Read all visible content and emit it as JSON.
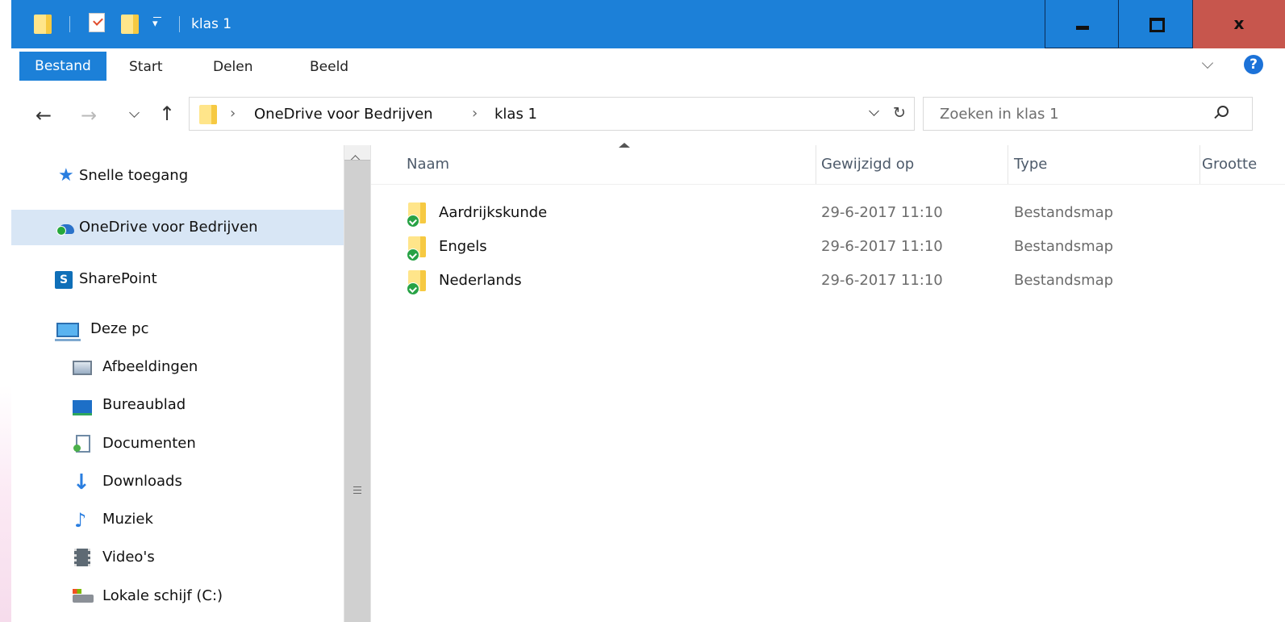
{
  "window": {
    "title": "klas 1",
    "close_label": "x"
  },
  "ribbon": {
    "tabs": [
      {
        "label": "Bestand"
      },
      {
        "label": "Start"
      },
      {
        "label": "Delen"
      },
      {
        "label": "Beeld"
      }
    ],
    "help_label": "?"
  },
  "address": {
    "segments": [
      "OneDrive voor Bedrijven",
      "klas 1"
    ]
  },
  "search": {
    "placeholder": "Zoeken in klas 1"
  },
  "nav_pane": {
    "items": [
      {
        "label": "Snelle toegang",
        "icon": "star-icon"
      },
      {
        "label": "OneDrive voor Bedrijven",
        "icon": "onedrive-icon",
        "selected": true
      },
      {
        "label": "SharePoint",
        "icon": "sharepoint-icon"
      },
      {
        "label": "Deze pc",
        "icon": "pc-icon"
      },
      {
        "label": "Afbeeldingen",
        "icon": "pictures-icon"
      },
      {
        "label": "Bureaublad",
        "icon": "desktop-icon"
      },
      {
        "label": "Documenten",
        "icon": "documents-icon"
      },
      {
        "label": "Downloads",
        "icon": "download-icon"
      },
      {
        "label": "Muziek",
        "icon": "music-icon"
      },
      {
        "label": "Video's",
        "icon": "video-icon"
      },
      {
        "label": "Lokale schijf (C:)",
        "icon": "drive-icon"
      }
    ]
  },
  "file_list": {
    "columns": [
      "Naam",
      "Gewijzigd op",
      "Type",
      "Grootte"
    ],
    "rows": [
      {
        "name": "Aardrijkskunde",
        "modified": "29-6-2017 11:10",
        "type": "Bestandsmap"
      },
      {
        "name": "Engels",
        "modified": "29-6-2017 11:10",
        "type": "Bestandsmap"
      },
      {
        "name": "Nederlands",
        "modified": "29-6-2017 11:10",
        "type": "Bestandsmap"
      }
    ]
  },
  "colors": {
    "accent": "#1c80d8",
    "close_button": "#c7564d",
    "selected_nav": "#d8e6f5",
    "sync_ok": "#27a245",
    "folder": "#ffe58a"
  }
}
